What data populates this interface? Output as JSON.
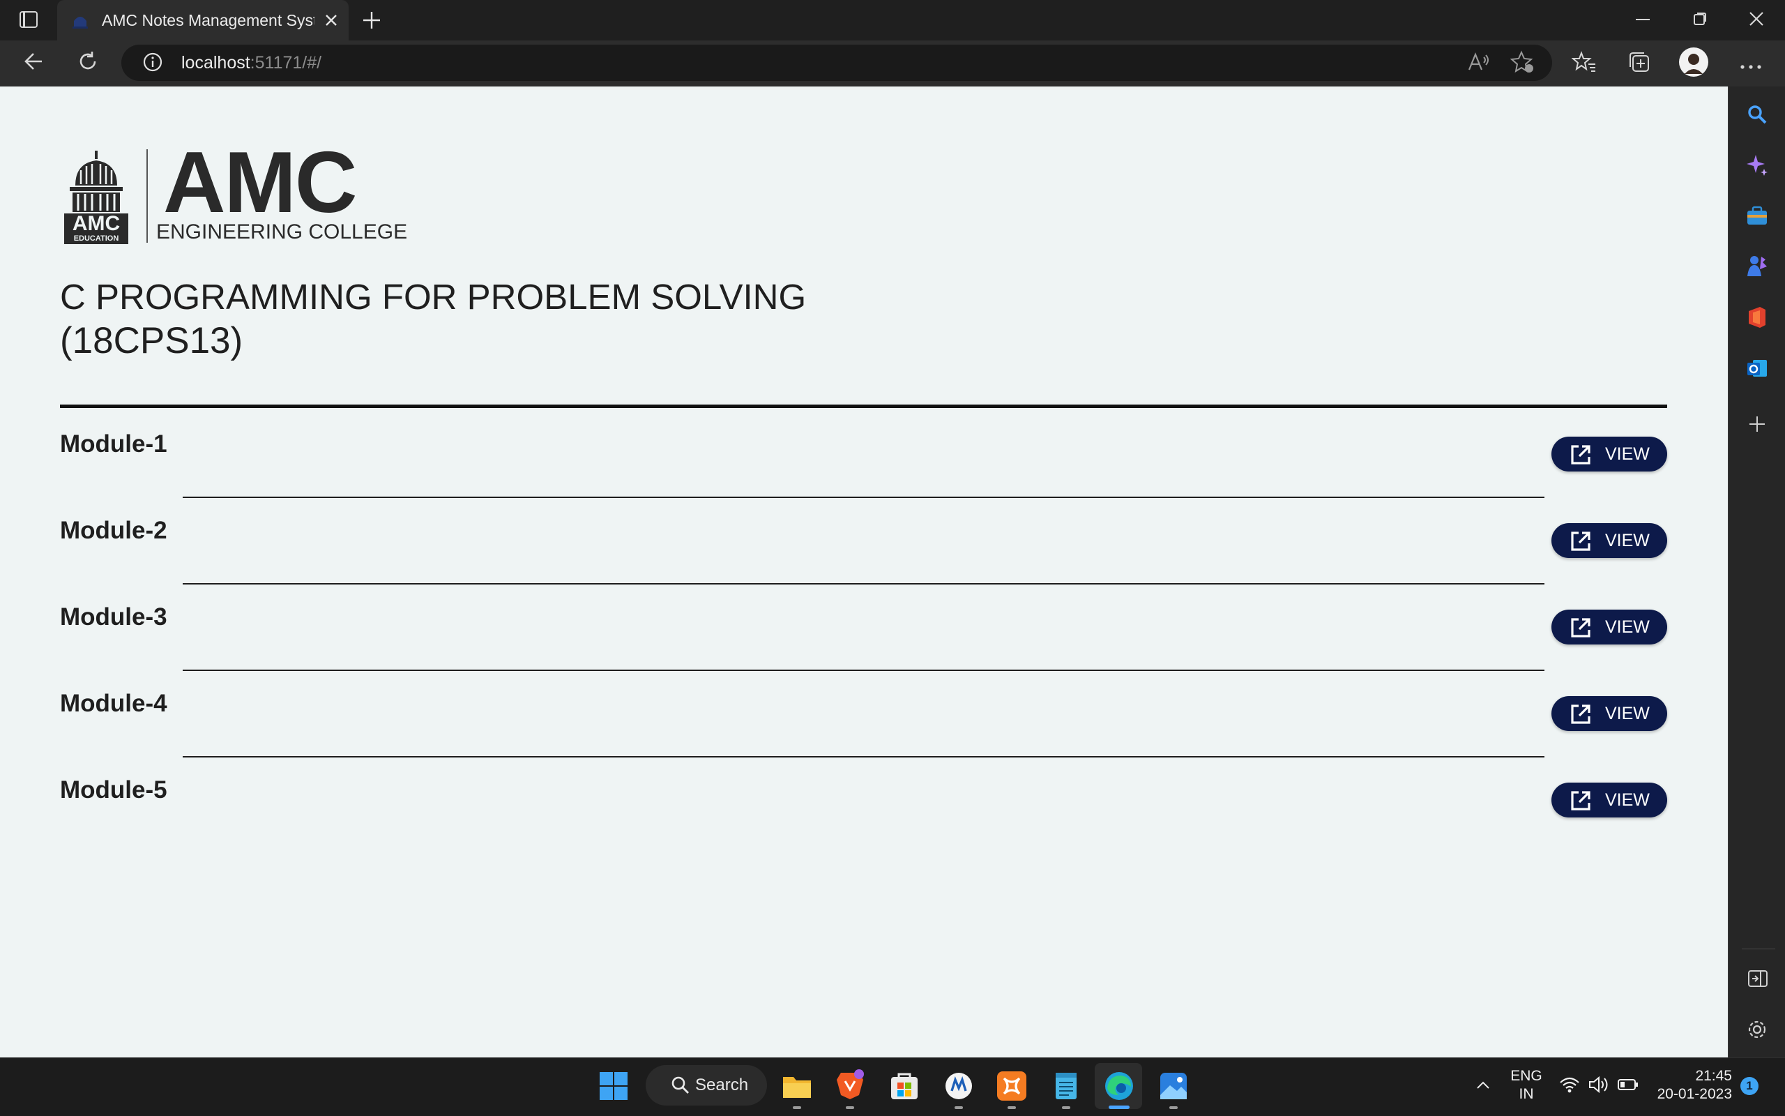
{
  "browser": {
    "tab_title": "AMC Notes Management System",
    "url_host": "localhost",
    "url_rest": ":51171/#/"
  },
  "logo": {
    "name": "AMC",
    "subtitle": "ENGINEERING COLLEGE",
    "seal_text": [
      "AMC",
      "EDUCATION"
    ]
  },
  "course": {
    "title": "C PROGRAMMING FOR PROBLEM SOLVING",
    "code": "(18CPS13)"
  },
  "modules": [
    {
      "label": "Module-1",
      "button": "VIEW"
    },
    {
      "label": "Module-2",
      "button": "VIEW"
    },
    {
      "label": "Module-3",
      "button": "VIEW"
    },
    {
      "label": "Module-4",
      "button": "VIEW"
    },
    {
      "label": "Module-5",
      "button": "VIEW"
    }
  ],
  "taskbar": {
    "search_label": "Search",
    "lang_line1": "ENG",
    "lang_line2": "IN",
    "time": "21:45",
    "date": "20-01-2023",
    "notification_count": "1"
  },
  "colors": {
    "page_bg": "#eff4f4",
    "button_bg": "#0d1a4a",
    "text": "#1f1f1f"
  },
  "icons": {
    "sidebar": [
      "search-icon",
      "copilot-icon",
      "tools-icon",
      "games-icon",
      "office-icon",
      "outlook-icon",
      "add-icon",
      "hide-sidebar-icon",
      "settings-icon"
    ],
    "taskbar_apps": [
      "windows-start-icon",
      "file-explorer-icon",
      "brave-icon",
      "store-icon",
      "app-icon",
      "xampp-icon",
      "notepad-icon",
      "edge-icon",
      "photos-icon"
    ]
  }
}
